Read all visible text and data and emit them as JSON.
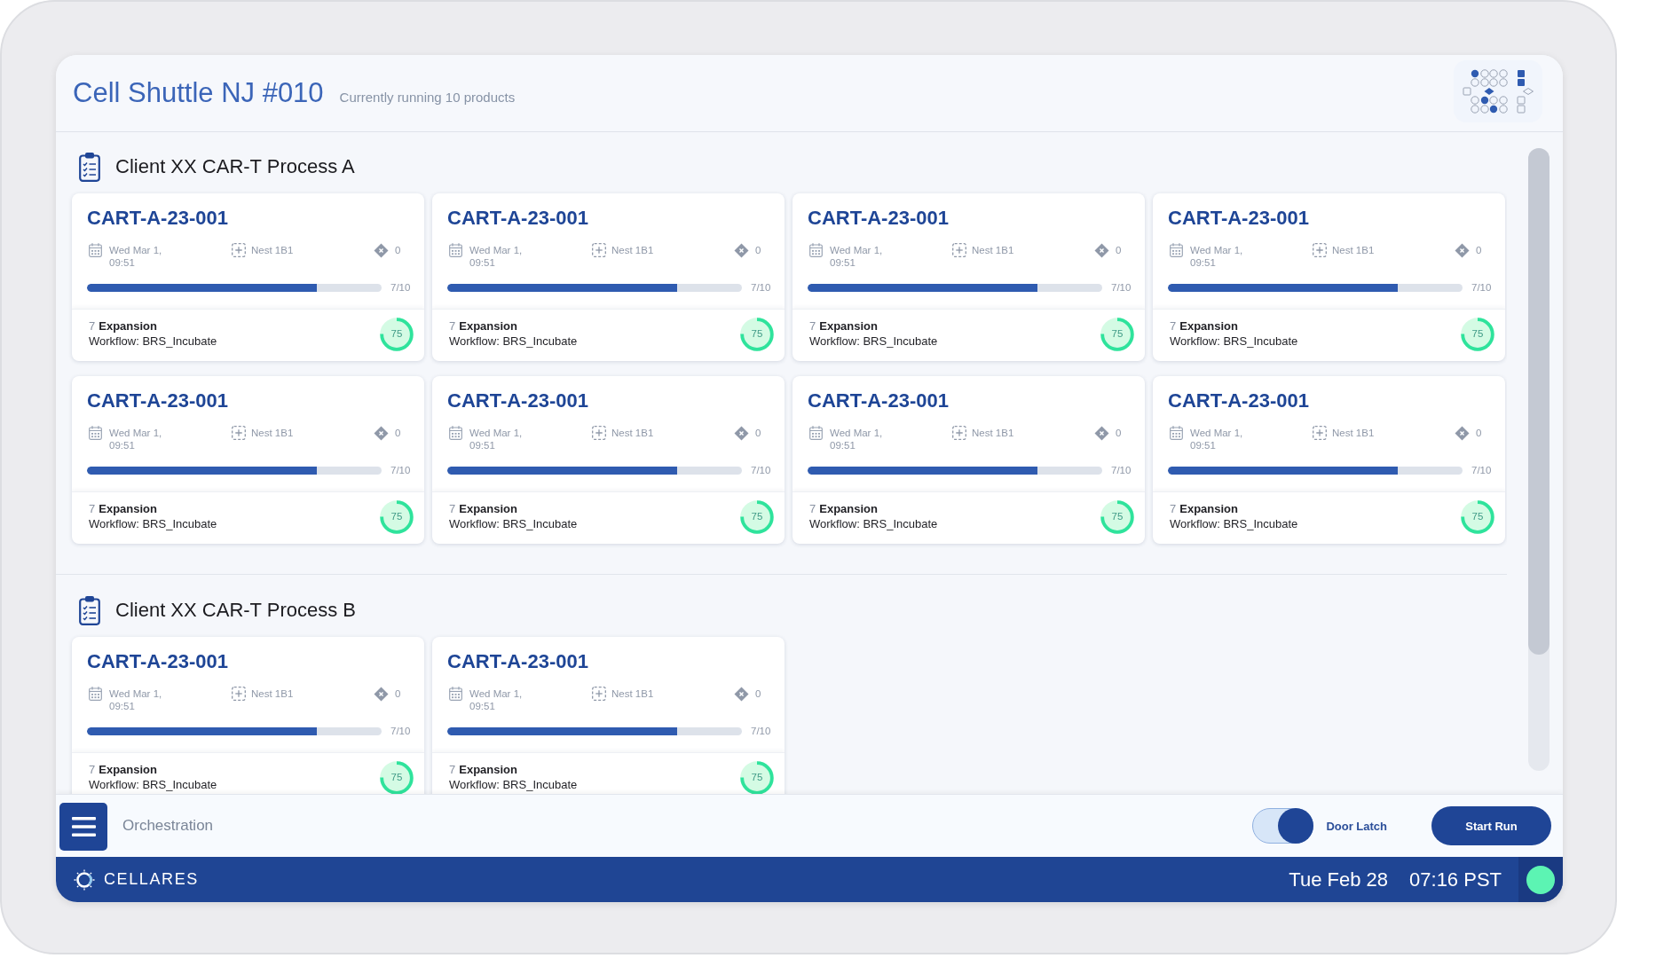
{
  "header": {
    "title": "Cell Shuttle NJ #010",
    "subtitle": "Currently running 10 products"
  },
  "sections": [
    {
      "title": "Client XX CAR-T Process A",
      "cards": [
        {
          "id": "CART-A-23-001",
          "date": "Wed Mar 1, 09:51",
          "nest": "Nest 1B1",
          "alerts": "0",
          "progress": {
            "level": 0.78,
            "reading": "7/10"
          },
          "step": "7",
          "stage": "Expansion",
          "workflow": "Workflow: BRS_Incubate",
          "score": "75"
        },
        {
          "id": "CART-A-23-001",
          "date": "Wed Mar 1, 09:51",
          "nest": "Nest 1B1",
          "alerts": "0",
          "progress": {
            "level": 0.78,
            "reading": "7/10"
          },
          "step": "7",
          "stage": "Expansion",
          "workflow": "Workflow: BRS_Incubate",
          "score": "75"
        },
        {
          "id": "CART-A-23-001",
          "date": "Wed Mar 1, 09:51",
          "nest": "Nest 1B1",
          "alerts": "0",
          "progress": {
            "level": 0.78,
            "reading": "7/10"
          },
          "step": "7",
          "stage": "Expansion",
          "workflow": "Workflow: BRS_Incubate",
          "score": "75"
        },
        {
          "id": "CART-A-23-001",
          "date": "Wed Mar 1, 09:51",
          "nest": "Nest 1B1",
          "alerts": "0",
          "progress": {
            "level": 0.78,
            "reading": "7/10"
          },
          "step": "7",
          "stage": "Expansion",
          "workflow": "Workflow: BRS_Incubate",
          "score": "75"
        },
        {
          "id": "CART-A-23-001",
          "date": "Wed Mar 1, 09:51",
          "nest": "Nest 1B1",
          "alerts": "0",
          "progress": {
            "level": 0.78,
            "reading": "7/10"
          },
          "step": "7",
          "stage": "Expansion",
          "workflow": "Workflow: BRS_Incubate",
          "score": "75"
        },
        {
          "id": "CART-A-23-001",
          "date": "Wed Mar 1, 09:51",
          "nest": "Nest 1B1",
          "alerts": "0",
          "progress": {
            "level": 0.78,
            "reading": "7/10"
          },
          "step": "7",
          "stage": "Expansion",
          "workflow": "Workflow: BRS_Incubate",
          "score": "75"
        },
        {
          "id": "CART-A-23-001",
          "date": "Wed Mar 1, 09:51",
          "nest": "Nest 1B1",
          "alerts": "0",
          "progress": {
            "level": 0.78,
            "reading": "7/10"
          },
          "step": "7",
          "stage": "Expansion",
          "workflow": "Workflow: BRS_Incubate",
          "score": "75"
        },
        {
          "id": "CART-A-23-001",
          "date": "Wed Mar 1, 09:51",
          "nest": "Nest 1B1",
          "alerts": "0",
          "progress": {
            "level": 0.78,
            "reading": "7/10"
          },
          "step": "7",
          "stage": "Expansion",
          "workflow": "Workflow: BRS_Incubate",
          "score": "75"
        }
      ]
    },
    {
      "title": "Client XX CAR-T Process B",
      "cards": [
        {
          "id": "CART-A-23-001",
          "date": "Wed Mar 1, 09:51",
          "nest": "Nest 1B1",
          "alerts": "0",
          "progress": {
            "level": 0.78,
            "reading": "7/10"
          },
          "step": "7",
          "stage": "Expansion",
          "workflow": "Workflow: BRS_Incubate",
          "score": "75"
        },
        {
          "id": "CART-A-23-001",
          "date": "Wed Mar 1, 09:51",
          "nest": "Nest 1B1",
          "alerts": "0",
          "progress": {
            "level": 0.78,
            "reading": "7/10"
          },
          "step": "7",
          "stage": "Expansion",
          "workflow": "Workflow: BRS_Incubate",
          "score": "75"
        }
      ]
    }
  ],
  "bottom_bar": {
    "label": "Orchestration",
    "door_latch": {
      "label": "Door Latch",
      "on": true
    },
    "start_button": "Start Run"
  },
  "status_bar": {
    "brand": "CELLARES",
    "date": "Tue Feb 28",
    "time": "07:16 PST"
  }
}
